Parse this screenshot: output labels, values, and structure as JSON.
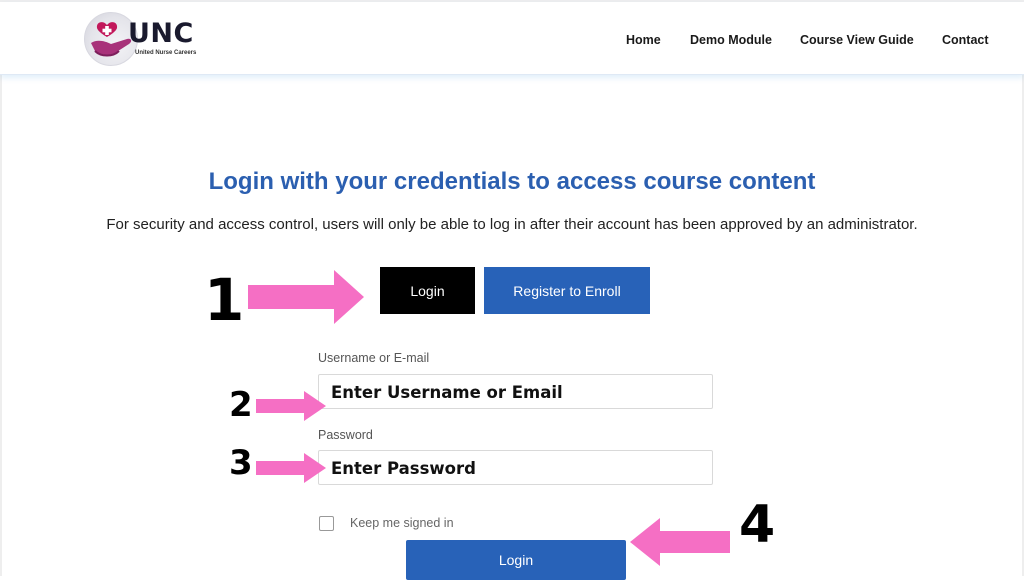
{
  "header": {
    "logo_text": "UNC",
    "logo_subtitle": "United Nurse Careers",
    "nav": [
      "Home",
      "Demo Module",
      "Course View Guide",
      "Contact"
    ]
  },
  "main": {
    "title": "Login with your credentials to access course content",
    "subtitle": "For security and access control, users will only be able to log in after their account has been approved by an administrator.",
    "tabs": {
      "login": "Login",
      "register": "Register to Enroll"
    },
    "form": {
      "username_label": "Username or E-mail",
      "username_overlay": "Enter Username or Email",
      "password_label": "Password",
      "password_overlay": "Enter Password",
      "remember_label": "Keep me signed in",
      "submit_label": "Login"
    }
  },
  "annotations": {
    "step1": "1",
    "step2": "2",
    "step3": "3",
    "step4": "4"
  },
  "colors": {
    "accent": "#2862b8",
    "title": "#2b5fb0",
    "arrow": "#f56fc4",
    "logo_pink": "#b23a7c"
  },
  "icons": [
    "logo-heart-hands-icon",
    "checkbox-icon",
    "arrow-right-icon",
    "arrow-left-icon"
  ]
}
